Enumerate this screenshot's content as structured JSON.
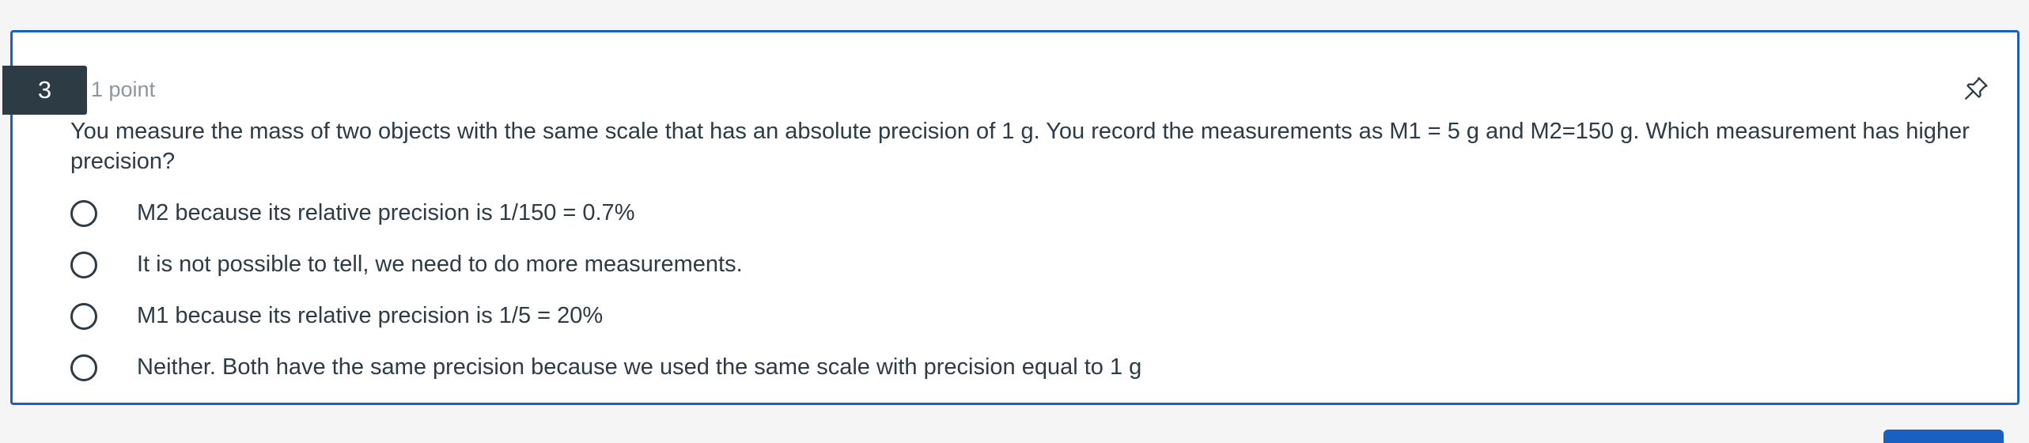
{
  "question": {
    "number": "3",
    "points": "1 point",
    "text": "You measure the mass of two objects with the same scale that has an absolute precision of 1 g. You record the measurements as M1 = 5 g and M2=150 g. Which measurement has higher precision?",
    "pin_icon": "pin-icon",
    "answers": [
      {
        "label": "M2 because its relative precision is 1/150 = 0.7%",
        "selected": false
      },
      {
        "label": "It is not possible to tell, we need to do more measurements.",
        "selected": false
      },
      {
        "label": "M1 because its relative precision is 1/5 = 20%",
        "selected": false
      },
      {
        "label": "Neither. Both have the same precision because we used the same scale with precision equal to 1 g",
        "selected": false
      }
    ]
  },
  "colors": {
    "accent": "#1a5fc2",
    "number_badge": "#2d3b45",
    "text": "#2d3b45",
    "muted": "#8b969e"
  }
}
